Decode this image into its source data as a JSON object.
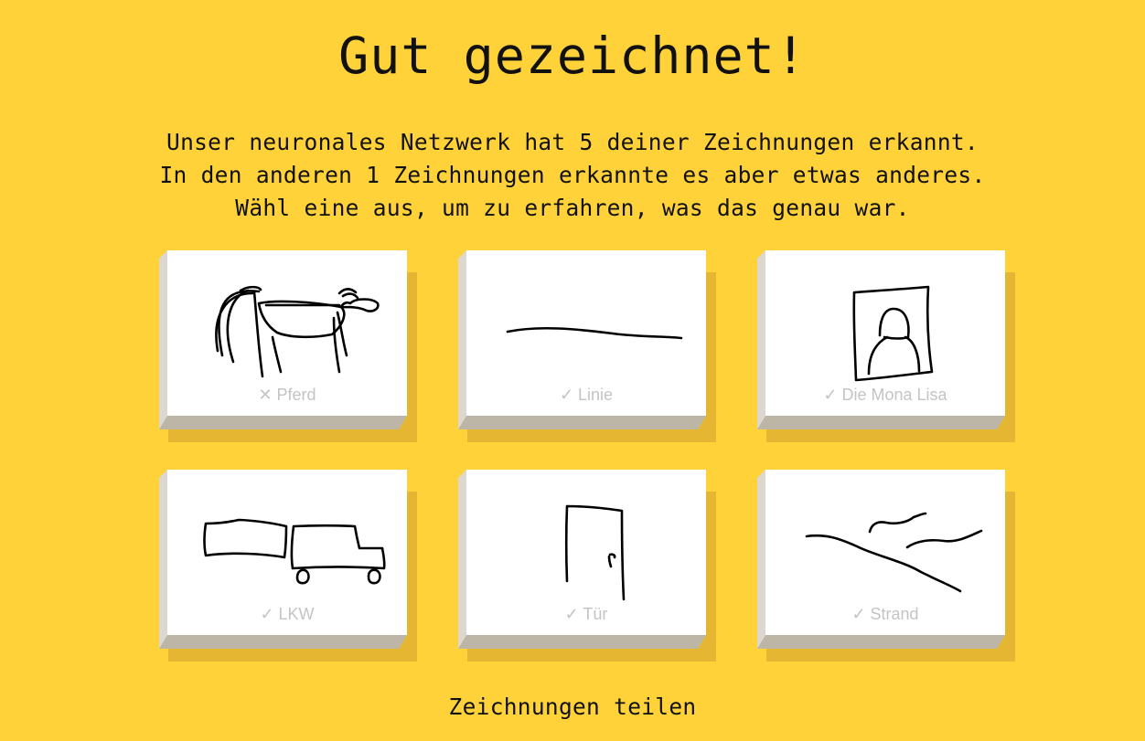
{
  "page": {
    "title": "Gut gezeichnet!",
    "subtitle_lines": [
      "Unser neuronales Netzwerk hat 5 deiner Zeichnungen erkannt.",
      "In den anderen 1 Zeichnungen erkannte es aber etwas anderes.",
      "Wähl eine aus, um zu erfahren, was das genau war."
    ],
    "share_label": "Zeichnungen teilen"
  },
  "colors": {
    "background": "#ffd239",
    "card_face": "#ffffff",
    "label": "#c4c4c4",
    "ink": "#000000"
  },
  "drawings": [
    {
      "label": "✕ Pferd",
      "recognized": false,
      "icon": "horse-drawing"
    },
    {
      "label": "✓ Linie",
      "recognized": true,
      "icon": "line-drawing"
    },
    {
      "label": "✓ Die Mona Lisa",
      "recognized": true,
      "icon": "mona-lisa-drawing"
    },
    {
      "label": "✓ LKW",
      "recognized": true,
      "icon": "truck-drawing"
    },
    {
      "label": "✓ Tür",
      "recognized": true,
      "icon": "door-drawing"
    },
    {
      "label": "✓ Strand",
      "recognized": true,
      "icon": "beach-drawing"
    }
  ]
}
